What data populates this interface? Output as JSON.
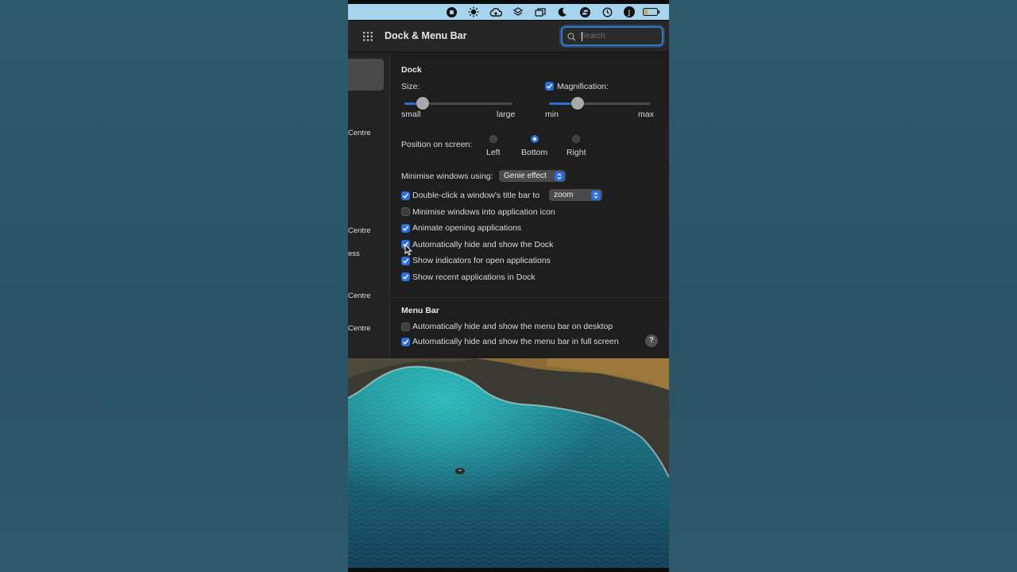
{
  "menubar": {
    "icons": [
      "record-icon",
      "brightness-icon",
      "cloud-icon",
      "layers-icon",
      "windows-icon",
      "moon-icon",
      "control-centre-icon",
      "time-machine-icon",
      "user-icon",
      "battery-icon"
    ],
    "user_initial": "J",
    "background": "#a6d4ee"
  },
  "window": {
    "title": "Dock & Menu Bar",
    "search_placeholder": "Search",
    "accent": "#2a6fdb"
  },
  "sidebar": {
    "labels": [
      "Centre",
      "Centre",
      "ess",
      "Centre",
      "Centre"
    ]
  },
  "dock": {
    "section_title": "Dock",
    "size_label": "Size:",
    "size_min": "small",
    "size_max": "large",
    "size_value": 0.17,
    "magnification_label": "Magnification:",
    "magnification_checked": true,
    "mag_min": "min",
    "mag_max": "max",
    "magnification_value": 0.28,
    "position_label": "Position on screen:",
    "positions": [
      "Left",
      "Bottom",
      "Right"
    ],
    "position_selected": "Bottom",
    "minimise_label": "Minimise windows using:",
    "minimise_value": "Genie effect",
    "doubleclick_label": "Double-click a window's title bar to",
    "doubleclick_value": "zoom",
    "options": [
      {
        "label": "Minimise windows into application icon",
        "checked": false
      },
      {
        "label": "Animate opening applications",
        "checked": true
      },
      {
        "label": "Automatically hide and show the Dock",
        "checked": true
      },
      {
        "label": "Show indicators for open applications",
        "checked": true
      },
      {
        "label": "Show recent applications in Dock",
        "checked": true
      }
    ]
  },
  "menu_bar_section": {
    "title": "Menu Bar",
    "options": [
      {
        "label": "Automatically hide and show the menu bar on desktop",
        "checked": false
      },
      {
        "label": "Automatically hide and show the menu bar in full screen",
        "checked": true
      }
    ],
    "help": "?"
  }
}
